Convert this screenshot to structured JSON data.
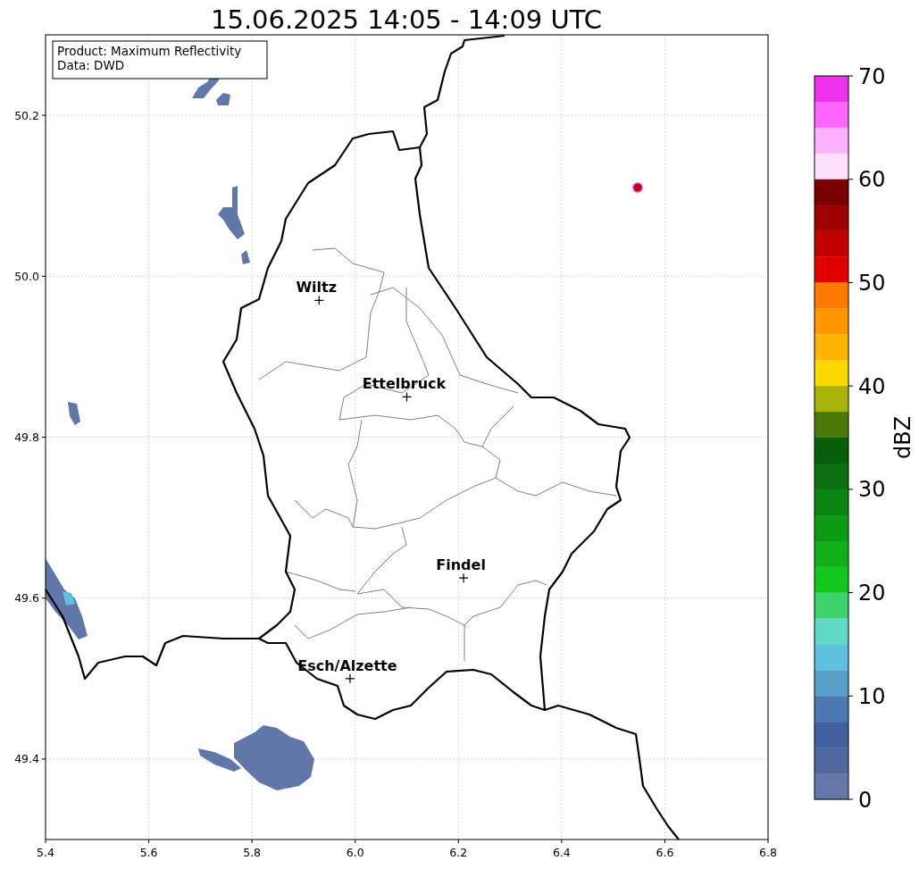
{
  "chart": {
    "chart_data": {
      "type": "scatter",
      "title": "15.06.2025 14:05 - 14:09 UTC",
      "grid": true,
      "x": [
        5.93,
        6.1,
        6.21,
        5.99
      ],
      "values": [
        49.97,
        49.85,
        49.625,
        49.5
      ],
      "xlim": [
        5.4,
        6.8
      ],
      "ylim": [
        49.3,
        50.3
      ],
      "xticks": [
        5.4,
        5.6,
        5.8,
        {
          "value": 6,
          "label": "6.0"
        },
        6.2,
        6.4,
        6.6,
        6.8
      ],
      "yticks": [
        49.4,
        49.6,
        49.8,
        {
          "value": 50,
          "label": "50.0"
        },
        50.2
      ],
      "annotations": [
        {
          "text": "Wiltz",
          "x": 5.93,
          "y": 49.97
        },
        {
          "text": "Ettelbruck",
          "x": 6.1,
          "y": 49.85
        },
        {
          "text": "Findel",
          "x": 6.21,
          "y": 49.625
        },
        {
          "text": "Esch/Alzette",
          "x": 5.99,
          "y": 49.5
        }
      ]
    },
    "info_box": [
      "Product: Maximum Reflectivity",
      "Data: DWD"
    ]
  },
  "colorbar": {
    "label": "dBZ",
    "ticks": [
      "70",
      "60",
      "50",
      "40",
      "30",
      "20",
      "10",
      "0"
    ],
    "segments": [
      {
        "color": "#ee33ee"
      },
      {
        "color": "#ff66ff"
      },
      {
        "color": "#ffb0ff"
      },
      {
        "color": "#ffe0ff"
      },
      {
        "color": "#7a0000"
      },
      {
        "color": "#a00000"
      },
      {
        "color": "#c00000"
      },
      {
        "color": "#e00000"
      },
      {
        "color": "#ff7b00"
      },
      {
        "color": "#ff9800"
      },
      {
        "color": "#ffb400"
      },
      {
        "color": "#ffd700"
      },
      {
        "color": "#aab30a"
      },
      {
        "color": "#4b7a0b"
      },
      {
        "color": "#065e0a"
      },
      {
        "color": "#0a700f"
      },
      {
        "color": "#0c8414"
      },
      {
        "color": "#0d9a16"
      },
      {
        "color": "#0fb018"
      },
      {
        "color": "#12c81c"
      },
      {
        "color": "#3cd26c"
      },
      {
        "color": "#60d8c8"
      },
      {
        "color": "#60c0e0"
      },
      {
        "color": "#58a0c8"
      },
      {
        "color": "#4a7ab0"
      },
      {
        "color": "#4060a0"
      },
      {
        "color": "#50689e"
      },
      {
        "color": "#6478a8"
      }
    ]
  }
}
